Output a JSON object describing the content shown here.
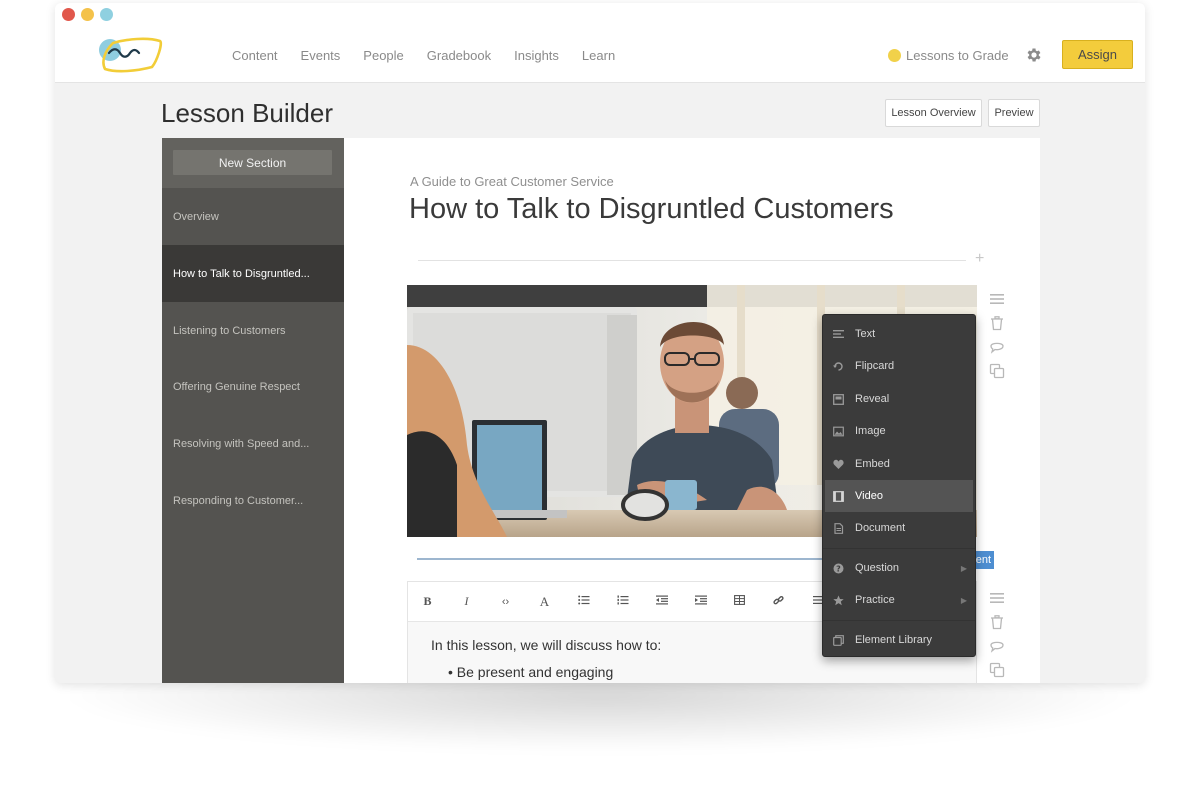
{
  "window": {
    "dot_colors": [
      "#e1584c",
      "#f4c24a",
      "#8fd0e0"
    ]
  },
  "nav": {
    "items": [
      "Content",
      "Events",
      "People",
      "Gradebook",
      "Insights",
      "Learn"
    ],
    "lessons_to_grade": "Lessons to Grade",
    "assign_label": "Assign"
  },
  "page": {
    "title": "Lesson Builder",
    "lesson_overview_label": "Lesson Overview",
    "preview_label": "Preview"
  },
  "sidebar": {
    "new_section_label": "New Section",
    "items": [
      {
        "label": "Overview"
      },
      {
        "label": "How to Talk to Disgruntled...",
        "active": true
      },
      {
        "label": "Listening to Customers"
      },
      {
        "label": "Offering Genuine Respect"
      },
      {
        "label": "Resolving with Speed and..."
      },
      {
        "label": "Responding to Customer..."
      }
    ]
  },
  "lesson": {
    "course_name": "A Guide to Great Customer Service",
    "title": "How to Talk to Disgruntled Customers",
    "blue_tag_label": "ent",
    "intro_text": "In this lesson, we will discuss how to:",
    "bullet_1": "• Be present and engaging"
  },
  "toolbar": {
    "bold": "B",
    "italic": "I",
    "code": "‹›",
    "font": "A"
  },
  "menu": {
    "items": [
      {
        "label": "Text",
        "icon": "text-icon"
      },
      {
        "label": "Flipcard",
        "icon": "flipcard-icon"
      },
      {
        "label": "Reveal",
        "icon": "reveal-icon"
      },
      {
        "label": "Image",
        "icon": "image-icon"
      },
      {
        "label": "Embed",
        "icon": "heart-icon"
      },
      {
        "label": "Video",
        "icon": "film-icon",
        "active": true
      },
      {
        "label": "Document",
        "icon": "document-icon"
      },
      {
        "label": "Question",
        "icon": "question-icon",
        "submenu": true
      },
      {
        "label": "Practice",
        "icon": "star-icon",
        "submenu": true
      },
      {
        "label": "Element Library",
        "icon": "library-icon"
      }
    ]
  },
  "colors": {
    "assign_bg": "#f3cc3c",
    "sidebar_bg": "#545350",
    "sidebar_active": "#3a3937",
    "menu_bg": "#3b3b3b",
    "menu_active": "#545454",
    "accent_blue": "#4e8ed1"
  }
}
